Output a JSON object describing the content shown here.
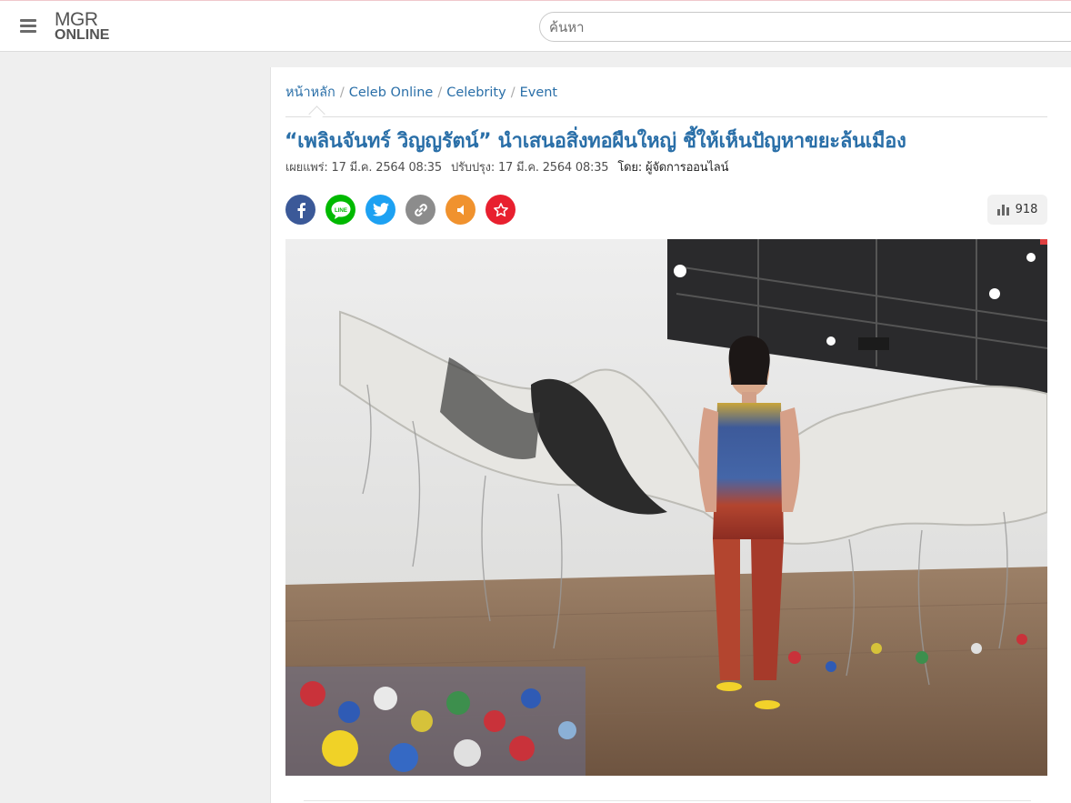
{
  "header": {
    "logo_line1": "MGR",
    "logo_line2": "ONLINE",
    "search_placeholder": "ค้นหา",
    "menu_icon": "hamburger-menu-icon"
  },
  "breadcrumb": [
    {
      "label": "หน้าหลัก"
    },
    {
      "label": "Celeb Online"
    },
    {
      "label": "Celebrity"
    },
    {
      "label": "Event"
    }
  ],
  "article": {
    "title": "“เพลินจันทร์ วิญญรัตน์” นำเสนอสิ่งทอผืนใหญ่ ชี้ให้เห็นปัญหาขยะล้นเมือง",
    "published_label": "เผยแพร่:",
    "published_value": "17 มี.ค. 2564 08:35",
    "updated_label": "ปรับปรุง:",
    "updated_value": "17 มี.ค. 2564 08:35",
    "author_label": "โดย:",
    "author_value": "ผู้จัดการออนไลน์",
    "view_count": "918"
  },
  "share_buttons": [
    {
      "name": "facebook",
      "icon": "facebook-icon",
      "color": "#3b5998"
    },
    {
      "name": "line",
      "icon": "line-icon",
      "color": "#00b900"
    },
    {
      "name": "twitter",
      "icon": "twitter-icon",
      "color": "#1da1f2"
    },
    {
      "name": "copy-link",
      "icon": "link-icon",
      "color": "#8c8c8c"
    },
    {
      "name": "speak",
      "icon": "speaker-icon",
      "color": "#f0922e"
    },
    {
      "name": "favorite",
      "icon": "star-icon",
      "color": "#e8202f"
    }
  ],
  "colors": {
    "link": "#2a6fa8",
    "page_bg": "#efefef"
  }
}
